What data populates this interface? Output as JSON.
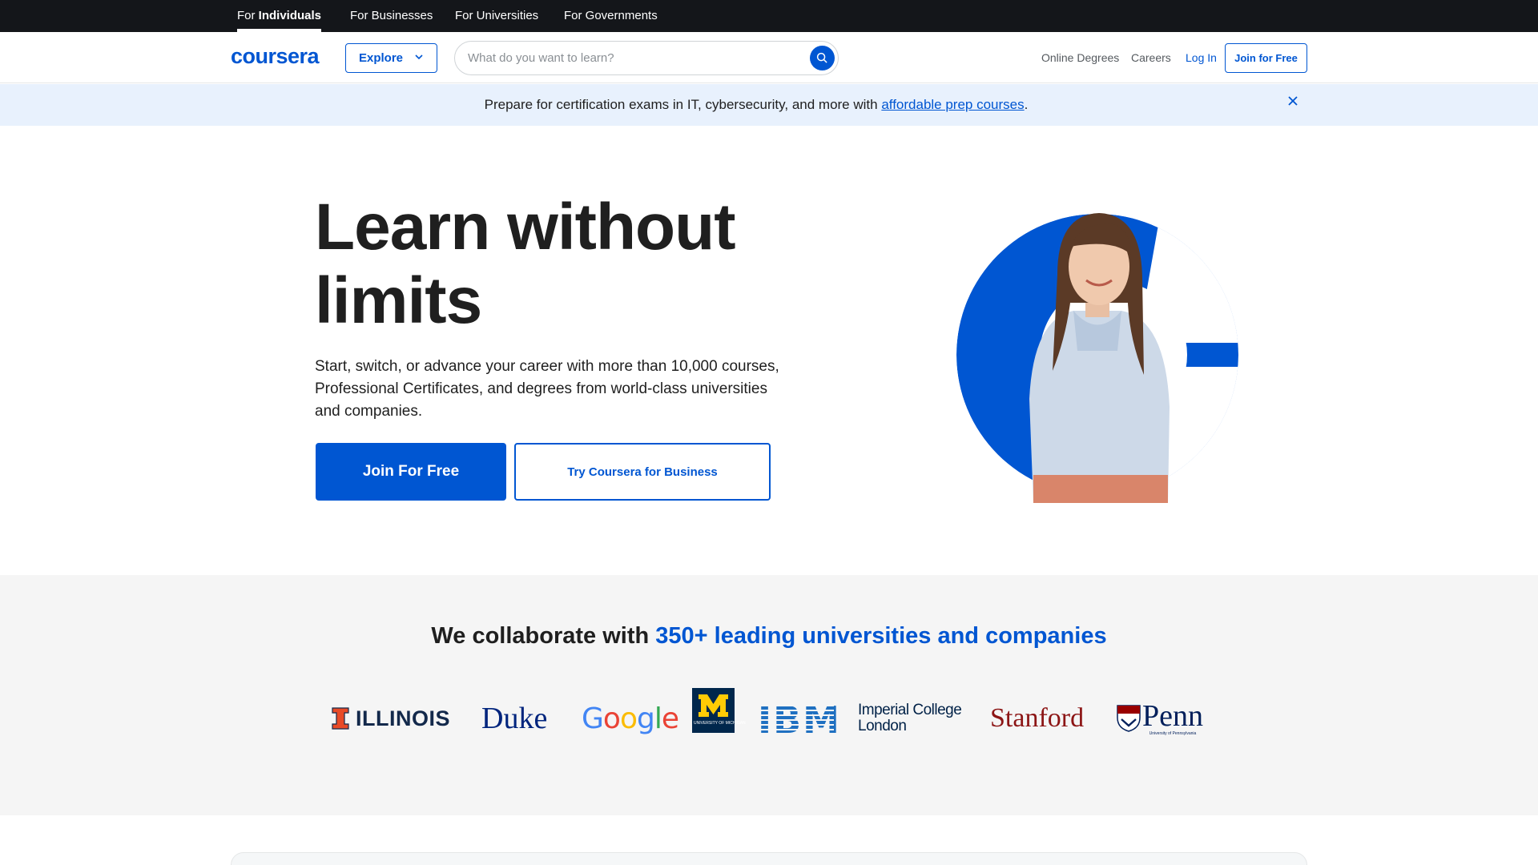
{
  "audience_tabs": [
    {
      "prefix": "For ",
      "emph": "Individuals",
      "active": true
    },
    {
      "label": "For Businesses"
    },
    {
      "label": "For Universities"
    },
    {
      "label": "For Governments"
    }
  ],
  "header": {
    "logo": "coursera",
    "explore_label": "Explore",
    "search_placeholder": "What do you want to learn?",
    "nav": {
      "online_degrees": "Online Degrees",
      "careers": "Careers",
      "login": "Log In",
      "join": "Join for Free"
    }
  },
  "banner": {
    "text_before": "Prepare for certification exams in IT, cybersecurity, and more with ",
    "link": "affordable prep courses",
    "text_after": "."
  },
  "hero": {
    "title": "Learn without limits",
    "subtitle": "Start, switch, or advance your career with more than 10,000 courses, Professional Certificates, and degrees from world-class universities and companies.",
    "primary_cta": "Join For Free",
    "secondary_cta": "Try Coursera for Business"
  },
  "partners": {
    "heading_prefix": "We collaborate with ",
    "heading_accent": "350+ leading universities and companies",
    "logos": {
      "illinois": "ILLINOIS",
      "duke": "Duke",
      "google": [
        "G",
        "o",
        "o",
        "g",
        "l",
        "e"
      ],
      "michigan": "UNIVERSITY OF MICHIGAN",
      "ibm": "IBM",
      "imperial_line1": "Imperial College",
      "imperial_line2": "London",
      "stanford": "Stanford",
      "penn": "Penn",
      "penn_sub": "University of Pennsylvania"
    }
  },
  "colors": {
    "brand": "#0056d2",
    "banner_bg": "#e8f1fd",
    "dark_bar": "#14161a"
  }
}
